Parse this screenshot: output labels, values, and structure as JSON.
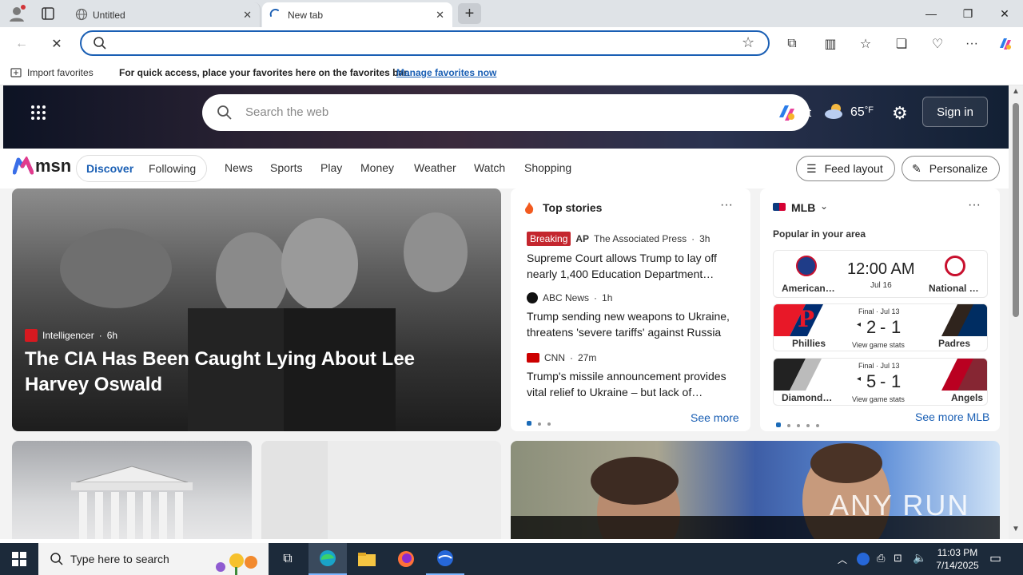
{
  "browser": {
    "tabs": [
      {
        "title": "Untitled"
      },
      {
        "title": "New tab"
      }
    ],
    "address_value": "",
    "favbar": {
      "import_label": "Import favorites",
      "message": "For quick access, place your favorites here on the favorites bar.",
      "manage_link": "Manage favorites now"
    }
  },
  "msn": {
    "search_placeholder": "Search the web",
    "weather_label": "rt",
    "temperature": "65",
    "temp_unit": "°F",
    "sign_in": "Sign in",
    "logo": "msn",
    "pills": [
      "Discover",
      "Following"
    ],
    "nav": [
      "News",
      "Sports",
      "Play",
      "Money",
      "Weather",
      "Watch",
      "Shopping"
    ],
    "feed_layout": "Feed layout",
    "personalize": "Personalize"
  },
  "hero_card": {
    "source": "Intelligencer",
    "age": "6h",
    "headline": "The CIA Has Been Caught Lying About Lee Harvey Oswald"
  },
  "top_stories": {
    "title": "Top stories",
    "breaking_badge": "Breaking",
    "items": [
      {
        "logo": "AP",
        "source": "The Associated Press",
        "age": "3h",
        "headline": "Supreme Court allows Trump to lay off nearly 1,400 Education Department…"
      },
      {
        "logo": "ABC",
        "source": "ABC News",
        "age": "1h",
        "headline": "Trump sending new weapons to Ukraine, threatens 'severe tariffs' against Russia"
      },
      {
        "logo": "CNN",
        "source": "CNN",
        "age": "27m",
        "headline": "Trump's missile announcement provides vital relief to Ukraine – but lack of…"
      }
    ],
    "see_more": "See more"
  },
  "mlb": {
    "title": "MLB",
    "subtitle": "Popular in your area",
    "games": [
      {
        "left_team": "American…",
        "right_team": "National …",
        "time": "12:00 AM",
        "date": "Jul 16"
      },
      {
        "left_team": "Phillies",
        "right_team": "Padres",
        "status": "Final · Jul 13",
        "score_left": "2",
        "score_right": "1",
        "stats": "View game stats",
        "left_color": "#e81828",
        "right_color": "#2f241d"
      },
      {
        "left_team": "Diamond…",
        "right_team": "Angels",
        "status": "Final · Jul 13",
        "score_left": "5",
        "score_right": "1",
        "stats": "View game stats",
        "left_color": "#a71930",
        "right_color": "#ba0021"
      }
    ],
    "see_more": "See more MLB"
  },
  "taskbar": {
    "search_placeholder": "Type here to search",
    "time": "11:03 PM",
    "date": "7/14/2025"
  },
  "watermark": "ANY RUN"
}
